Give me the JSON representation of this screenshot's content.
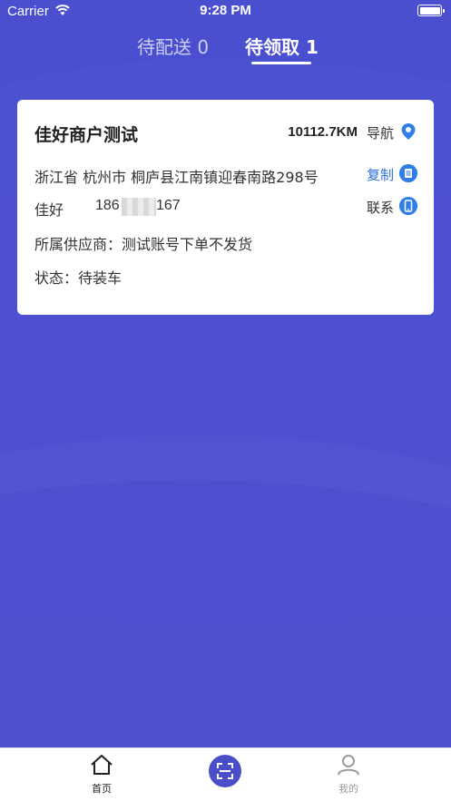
{
  "status_bar": {
    "carrier": "Carrier",
    "time": "9:28 PM",
    "battery_level": 1.0
  },
  "tabs": [
    {
      "label": "待配送 0",
      "active": false
    },
    {
      "label": "待领取 1",
      "active": true
    }
  ],
  "order_card": {
    "store_name": "佳好商户测试",
    "distance": "10112.7KM",
    "navigate_label": "导航",
    "navigate_icon": "location-pin-icon",
    "address": "浙江省 杭州市 桐庐县江南镇迎春南路298号",
    "copy_label": "复制",
    "copy_icon": "document-icon",
    "contact_name": "佳好",
    "phone_prefix": "186",
    "phone_suffix": "167",
    "contact_label": "联系",
    "contact_icon": "phone-icon",
    "supplier": "所属供应商：测试账号下单不发货",
    "status": "状态：待装车"
  },
  "tab_bar": {
    "home_label": "首页",
    "home_icon": "home-icon",
    "scan_icon": "scan-icon",
    "mine_label": "我的",
    "mine_icon": "user-icon"
  },
  "colors": {
    "background": "#4a52cf",
    "accent": "#2f7fe6",
    "scan_button": "#4a4fc9"
  }
}
